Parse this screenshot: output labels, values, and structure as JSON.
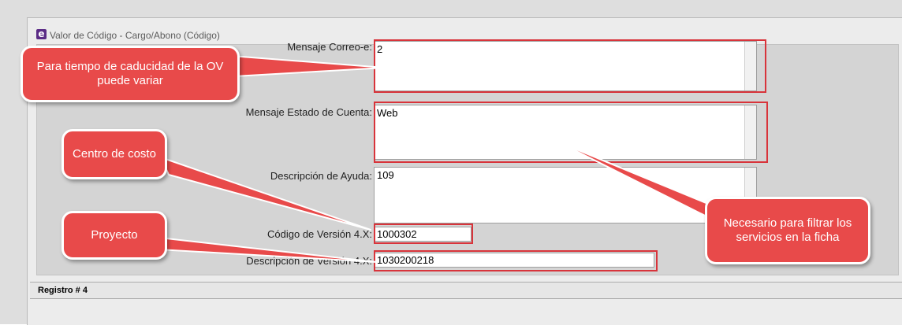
{
  "window": {
    "title": "Valor de Código - Cargo/Abono (Código)",
    "app_icon_glyph": "e"
  },
  "form": {
    "fields": [
      {
        "label": "Mensaje Correo-e:",
        "value": "2"
      },
      {
        "label": "Mensaje Estado de Cuenta:",
        "value": "Web"
      },
      {
        "label": "Descripción de Ayuda:",
        "value": "109"
      },
      {
        "label": "Código de Versión 4.X:",
        "value": "1000302"
      },
      {
        "label": "Descripción de Versión 4.X:",
        "value": "1030200218"
      }
    ]
  },
  "status_bar": {
    "text": "Registro # 4"
  },
  "annotations": {
    "caducidad": "Para tiempo de caducidad de  la OV puede variar",
    "centro_costo": "Centro de costo",
    "proyecto": "Proyecto",
    "filtrar": "Necesario para filtrar los servicios en la ficha"
  },
  "colors": {
    "annotation": "#e84a4a",
    "highlight": "#d8343b"
  }
}
